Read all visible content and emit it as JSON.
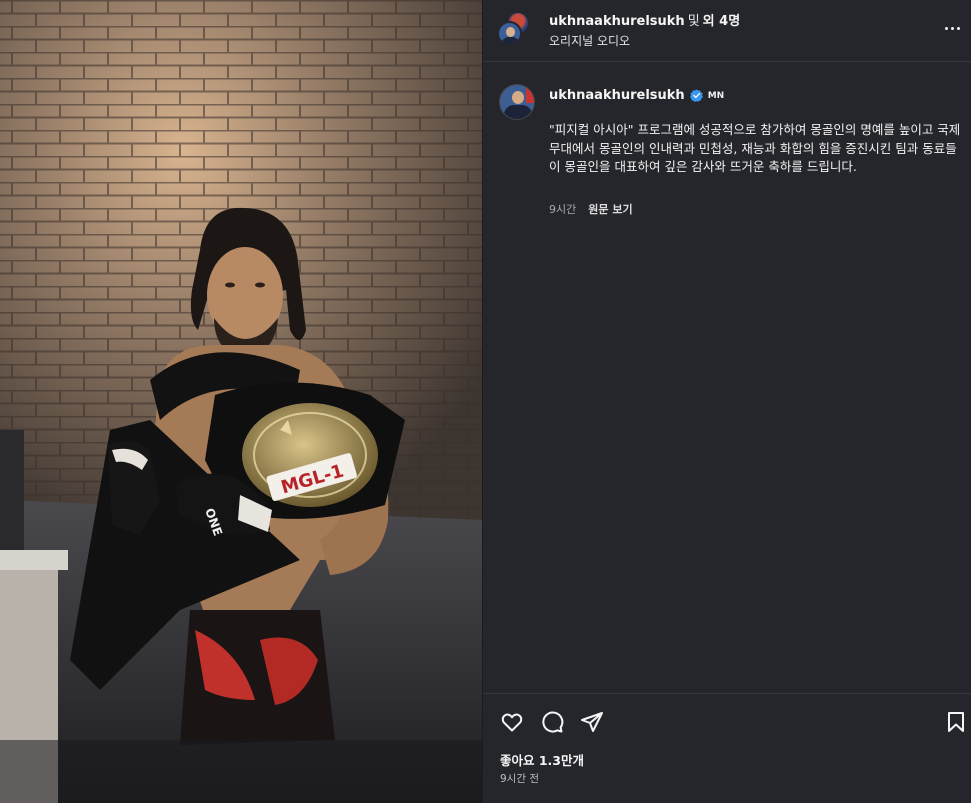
{
  "header": {
    "username": "ukhnaakhurelsukh",
    "joiner": "및",
    "others": "외 4명",
    "audio": "오리지널 오디오",
    "more_icon": "more-horizontal-icon"
  },
  "caption": {
    "username": "ukhnaakhurelsukh",
    "badge_icon": "verified-badge-icon",
    "country_tag": "MN",
    "text": "\"피지컬 아시아\" 프로그램에 성공적으로 참가하여 몽골인의 명예를 높이고 국제무대에서 몽골인의 인내력과 민첩성, 재능과 화합의 힘을 증진시킨 팀과 동료들이 몽골인을 대표하여 깊은 감사와 뜨거운 축하를 드립니다.",
    "time": "9시간",
    "see_original": "원문 보기"
  },
  "actions": {
    "icons": [
      "heart-icon",
      "comment-icon",
      "share-icon",
      "bookmark-icon"
    ],
    "likes": "좋아요 1.3만개",
    "time": "9시간 전"
  },
  "media": {
    "belt_text": "MGL-1",
    "glove_text": "ONE"
  },
  "colors": {
    "panel_bg": "#25262b",
    "verified": "#3897f0",
    "text": "#f5f5f5"
  }
}
